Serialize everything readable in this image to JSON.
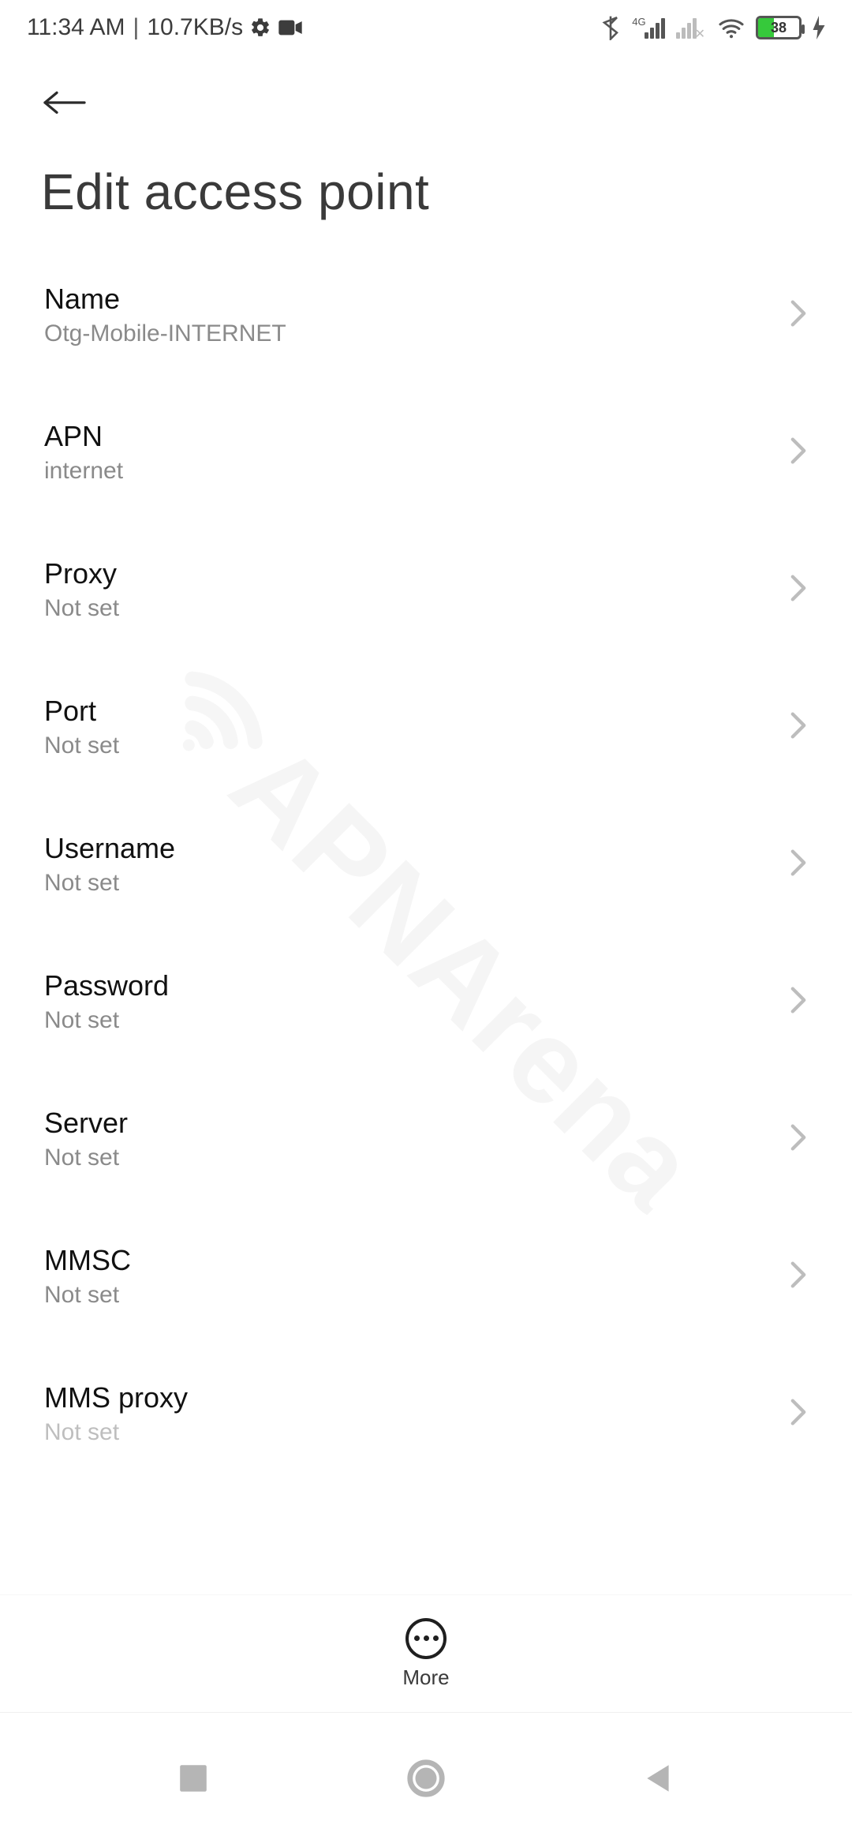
{
  "status": {
    "time": "11:34 AM",
    "speed": "10.7KB/s",
    "network_label": "4G",
    "battery_pct": "38"
  },
  "page": {
    "title": "Edit access point"
  },
  "rows": {
    "name": {
      "label": "Name",
      "value": "Otg-Mobile-INTERNET"
    },
    "apn": {
      "label": "APN",
      "value": "internet"
    },
    "proxy": {
      "label": "Proxy",
      "value": "Not set"
    },
    "port": {
      "label": "Port",
      "value": "Not set"
    },
    "username": {
      "label": "Username",
      "value": "Not set"
    },
    "password": {
      "label": "Password",
      "value": "Not set"
    },
    "server": {
      "label": "Server",
      "value": "Not set"
    },
    "mmsc": {
      "label": "MMSC",
      "value": "Not set"
    },
    "mmsproxy": {
      "label": "MMS proxy",
      "value": "Not set"
    }
  },
  "more_label": "More",
  "watermark": "APNArena"
}
